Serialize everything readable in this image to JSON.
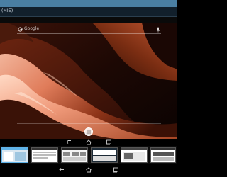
{
  "host": {
    "title_text": "(MIE)"
  },
  "launcher": {
    "search_placeholder": "Google",
    "icons": {
      "search": "google-g-icon",
      "mic": "mic-icon",
      "all_apps": "all-apps-icon"
    }
  },
  "device_nav": {
    "buttons": [
      "back-icon",
      "home-icon",
      "recents-icon"
    ]
  },
  "recents": {
    "count": 6,
    "selected_index": 0
  },
  "bottom_nav": {
    "buttons": [
      "back-icon",
      "home-icon",
      "recents-icon"
    ]
  },
  "colors": {
    "host_top_bar": "#4a7fa3",
    "host_title_bar": "#12202c",
    "selected_thumb_border": "#5fb3e8"
  }
}
